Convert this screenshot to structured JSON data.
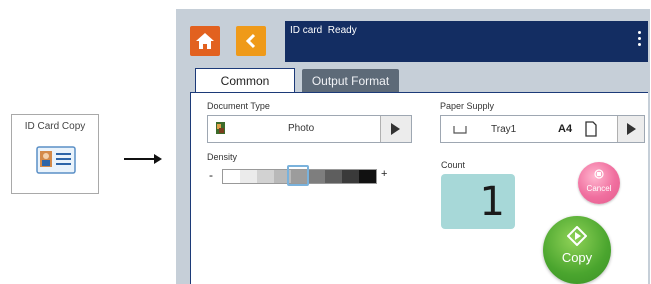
{
  "app_tile": {
    "label": "ID Card Copy",
    "icon": "id-card-icon"
  },
  "status_bar": {
    "text": "ID card  Ready",
    "menu_icon": "kebab-menu-icon"
  },
  "nav": {
    "home_icon": "home-icon",
    "back_icon": "back-chevron-icon"
  },
  "tabs": [
    {
      "label": "Common",
      "selected": true
    },
    {
      "label": "Output Format",
      "selected": false
    }
  ],
  "document_type": {
    "label": "Document Type",
    "value": "Photo"
  },
  "density": {
    "label": "Density",
    "minus": "-",
    "plus": "+",
    "level": 5,
    "levels": 9
  },
  "paper_supply": {
    "label": "Paper Supply",
    "tray": "Tray1",
    "size": "A4"
  },
  "count": {
    "label": "Count",
    "value": "1"
  },
  "cancel_button": {
    "label": "Cancel"
  },
  "copy_button": {
    "label": "Copy"
  },
  "colors": {
    "topbar": "#132d62",
    "home": "#e2611f",
    "back": "#ef9a19",
    "copy": "#4aa52e",
    "cancel": "#f06f9f",
    "count_bg": "#a7d8d8"
  }
}
